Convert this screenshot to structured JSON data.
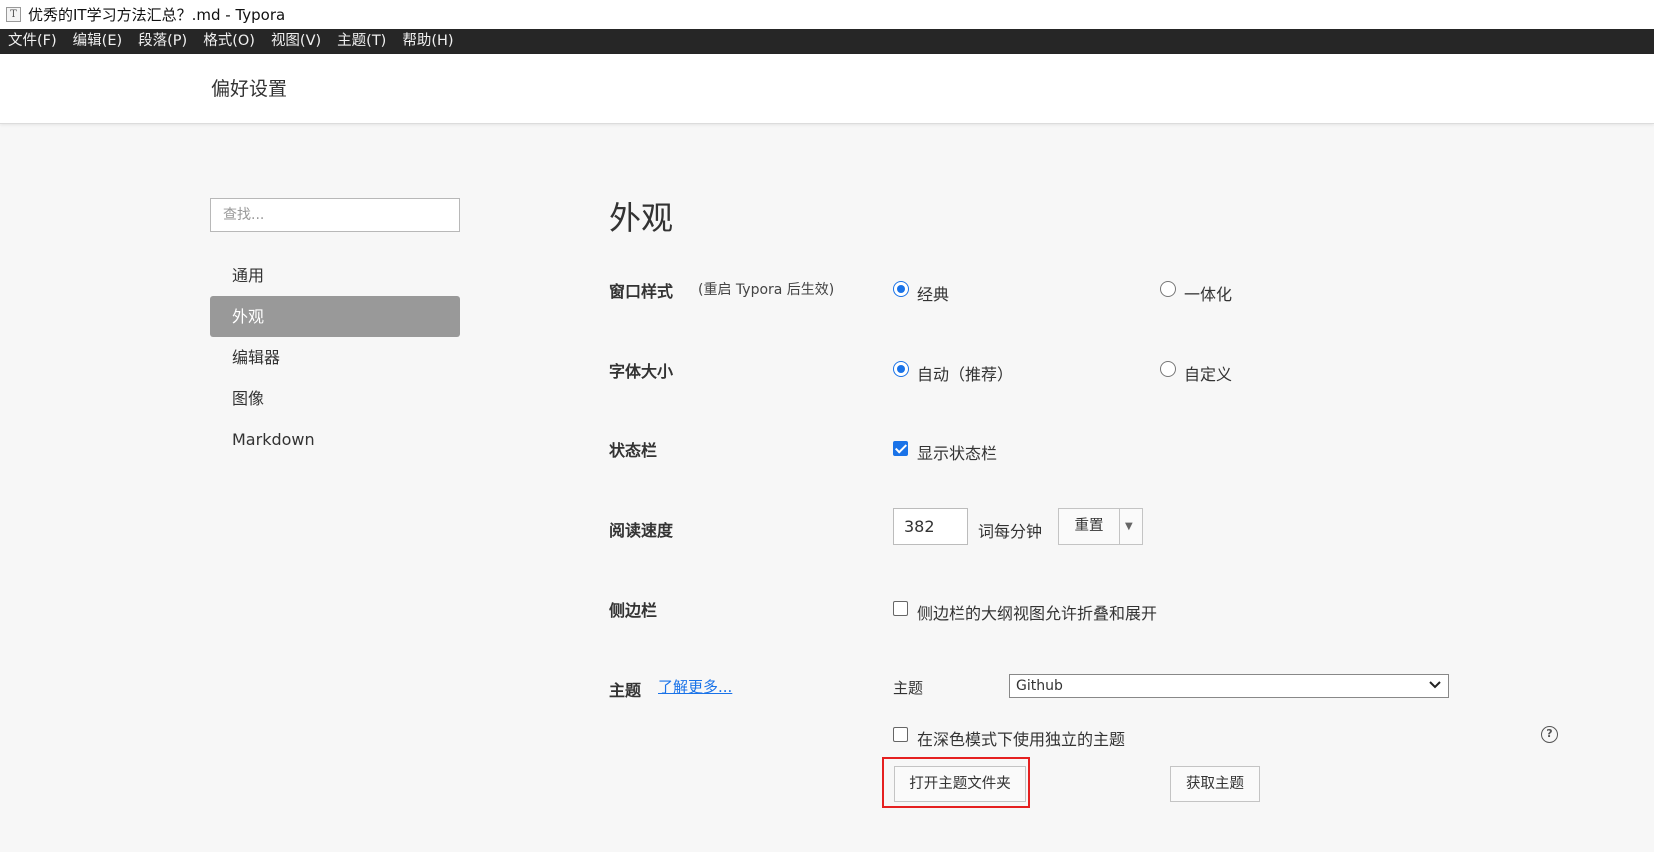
{
  "window": {
    "title": "优秀的IT学习方法汇总？.md - Typora",
    "app_icon_glyph": "T"
  },
  "menubar": {
    "items": [
      "文件(F)",
      "编辑(E)",
      "段落(P)",
      "格式(O)",
      "视图(V)",
      "主题(T)",
      "帮助(H)"
    ]
  },
  "prefs": {
    "title": "偏好设置",
    "search": {
      "placeholder": "查找...",
      "value": ""
    },
    "nav": {
      "items": [
        "通用",
        "外观",
        "编辑器",
        "图像",
        "Markdown"
      ],
      "selected": "外观"
    }
  },
  "appearance": {
    "heading": "外观",
    "window_style": {
      "label": "窗口样式",
      "note": "(重启 Typora 后生效)",
      "options": [
        "经典",
        "一体化"
      ],
      "selected": "经典"
    },
    "font_size": {
      "label": "字体大小",
      "options": [
        "自动（推荐）",
        "自定义"
      ],
      "selected": "自动（推荐）"
    },
    "status_bar": {
      "label": "状态栏",
      "checkbox_label": "显示状态栏",
      "checked": true
    },
    "reading_speed": {
      "label": "阅读速度",
      "value": "382",
      "unit": "词每分钟",
      "reset_label": "重置"
    },
    "sidebar": {
      "label": "侧边栏",
      "checkbox_label": "侧边栏的大纲视图允许折叠和展开",
      "checked": false
    },
    "theme": {
      "label": "主题",
      "learn_more": "了解更多...",
      "select_label": "主题",
      "selected": "Github",
      "dark_mode_label": "在深色模式下使用独立的主题",
      "dark_mode_checked": false,
      "open_folder_label": "打开主题文件夹",
      "get_themes_label": "获取主题"
    }
  },
  "colors": {
    "accent": "#1a73e8",
    "menubar_bg": "#262626",
    "nav_selected_bg": "#999999",
    "highlight_box": "#e52020"
  }
}
